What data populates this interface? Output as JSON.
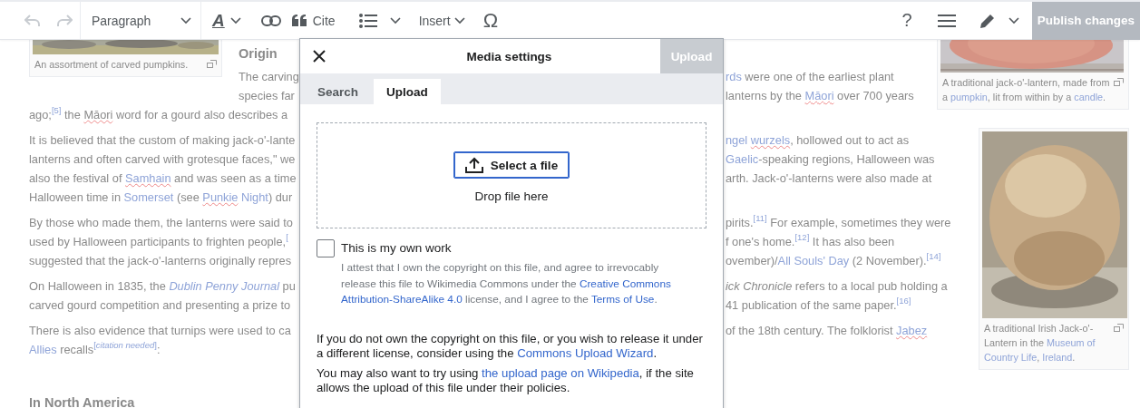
{
  "toolbar": {
    "undo": {
      "disabled": true
    },
    "redo": {
      "disabled": true
    },
    "paragraph_format": "Paragraph",
    "text_style": "A",
    "cite": "Cite",
    "insert": "Insert",
    "special_character": "Ω",
    "help": "?",
    "publish": {
      "label": "Publish changes",
      "disabled": true
    }
  },
  "article": {
    "left_figure": {
      "caption": [
        {
          "kind": "text",
          "s": "An assortment of carved pumpkins."
        }
      ]
    },
    "right_figures": [
      {
        "caption": [
          {
            "kind": "text",
            "s": "A traditional jack-o'-lantern, made from a "
          },
          {
            "kind": "link",
            "s": "pumpkin"
          },
          {
            "kind": "text",
            "s": ", lit from within by a "
          },
          {
            "kind": "link",
            "s": "candle"
          },
          {
            "kind": "text",
            "s": "."
          }
        ]
      },
      {
        "caption": [
          {
            "kind": "text",
            "s": "A traditional Irish Jack-o'-Lantern in the "
          },
          {
            "kind": "link",
            "s": "Museum of "
          },
          {
            "kind": "link",
            "s": "Country Life"
          },
          {
            "kind": "text",
            "s": ", "
          },
          {
            "kind": "link",
            "s": "Ireland"
          },
          {
            "kind": "text",
            "s": "."
          }
        ]
      }
    ],
    "blocks": [
      {
        "kind": "heading",
        "text": "Origin"
      },
      {
        "kind": "paragraph",
        "lines": [
          {
            "left": [
              {
                "kind": "text",
                "s": "The carving"
              }
            ],
            "right": [
              {
                "kind": "link",
                "s": "rds"
              },
              {
                "kind": "text",
                "s": " were one of the earliest plant"
              }
            ]
          },
          {
            "left": [
              {
                "kind": "text",
                "s": "species far"
              }
            ],
            "right": [
              {
                "kind": "text",
                "s": "lanterns by the "
              },
              {
                "kind": "link-misspelled",
                "s": "Māori"
              },
              {
                "kind": "text",
                "s": " over 700 years"
              }
            ]
          },
          {
            "left": [
              {
                "kind": "text",
                "s": "ago;"
              },
              {
                "kind": "ref",
                "s": "[5]"
              },
              {
                "kind": "text",
                "s": " the "
              },
              {
                "kind": "text-misspelled",
                "s": "Māori"
              },
              {
                "kind": "text",
                "s": " word for a gourd also describes a"
              }
            ]
          }
        ]
      },
      {
        "kind": "paragraph",
        "lines": [
          {
            "left": [
              {
                "kind": "text",
                "s": "It is believed that the custom of making jack-o'-lante"
              }
            ],
            "right": [
              {
                "kind": "link",
                "s": "ngel "
              },
              {
                "kind": "link-misspelled",
                "s": "wurzels"
              },
              {
                "kind": "text",
                "s": ", hollowed out to act as"
              }
            ]
          },
          {
            "left": [
              {
                "kind": "text",
                "s": "lanterns and often carved with grotesque faces,\" we"
              }
            ],
            "right": [
              {
                "kind": "link",
                "s": "Gaelic"
              },
              {
                "kind": "text",
                "s": "-speaking regions, Halloween was"
              }
            ]
          },
          {
            "left": [
              {
                "kind": "text",
                "s": "also the festival of "
              },
              {
                "kind": "link-misspelled",
                "s": "Samhain"
              },
              {
                "kind": "text",
                "s": " and was seen as a time"
              }
            ],
            "right": [
              {
                "kind": "text",
                "s": "arth. Jack-o'-lanterns were also made at"
              }
            ]
          },
          {
            "left": [
              {
                "kind": "text",
                "s": "Halloween time in "
              },
              {
                "kind": "link",
                "s": "Somerset"
              },
              {
                "kind": "text",
                "s": " (see "
              },
              {
                "kind": "link-misspelled",
                "s": "Punkie"
              },
              {
                "kind": "link",
                "s": " Night"
              },
              {
                "kind": "text",
                "s": ") dur"
              }
            ]
          }
        ]
      },
      {
        "kind": "paragraph",
        "lines": [
          {
            "left": [
              {
                "kind": "text",
                "s": "By those who made them, the lanterns were said to"
              }
            ],
            "right": [
              {
                "kind": "text",
                "s": "pirits."
              },
              {
                "kind": "ref",
                "s": "[11]"
              },
              {
                "kind": "text",
                "s": " For example, sometimes they were"
              }
            ]
          },
          {
            "left": [
              {
                "kind": "text",
                "s": "used by Halloween participants to frighten people,"
              },
              {
                "kind": "ref",
                "s": "["
              }
            ],
            "right": [
              {
                "kind": "text",
                "s": "f one's home."
              },
              {
                "kind": "ref",
                "s": "[12]"
              },
              {
                "kind": "text",
                "s": " It has also been"
              }
            ]
          },
          {
            "left": [
              {
                "kind": "text",
                "s": "suggested that the jack-o'-lanterns originally repres"
              }
            ],
            "right": [
              {
                "kind": "text",
                "s": "ovember)/"
              },
              {
                "kind": "link",
                "s": "All Souls' Day"
              },
              {
                "kind": "text",
                "s": " (2 November)."
              },
              {
                "kind": "ref",
                "s": "[14]"
              }
            ]
          }
        ]
      },
      {
        "kind": "paragraph",
        "lines": [
          {
            "left": [
              {
                "kind": "text",
                "s": "On Halloween in 1835, the "
              },
              {
                "kind": "italic-link",
                "s": "Dublin Penny Journal"
              },
              {
                "kind": "text",
                "s": " pu"
              }
            ],
            "right": [
              {
                "kind": "italic",
                "s": "ick Chronicle"
              },
              {
                "kind": "text",
                "s": " refers to a local pub holding a"
              }
            ]
          },
          {
            "left": [
              {
                "kind": "text",
                "s": "carved gourd competition and presenting a prize to"
              }
            ],
            "right": [
              {
                "kind": "text",
                "s": "41 publication of the same paper."
              },
              {
                "kind": "ref",
                "s": "[16]"
              }
            ]
          }
        ]
      },
      {
        "kind": "paragraph",
        "lines": [
          {
            "left": [
              {
                "kind": "text",
                "s": "There is also evidence that turnips were used to ca"
              }
            ],
            "right": [
              {
                "kind": "text",
                "s": "of the 18th century. The folklorist "
              },
              {
                "kind": "link-misspelled",
                "s": "Jabez"
              }
            ]
          },
          {
            "left": [
              {
                "kind": "link",
                "s": "Allies"
              },
              {
                "kind": "text",
                "s": " recalls"
              },
              {
                "kind": "ref",
                "s": "[*citation needed*]"
              },
              {
                "kind": "text",
                "s": ":"
              }
            ]
          }
        ]
      },
      {
        "kind": "heading",
        "text": "In North America"
      }
    ]
  },
  "dialog": {
    "title": "Media settings",
    "action": {
      "label": "Upload",
      "disabled": true
    },
    "tabs": [
      {
        "label": "Search",
        "selected": false
      },
      {
        "label": "Upload",
        "selected": true
      }
    ],
    "select_button": "Select a file",
    "drop_hint": "Drop file here",
    "own_work": {
      "label": "This is my own work",
      "checked": false,
      "description": [
        {
          "kind": "text",
          "s": "I attest that I own the copyright on this file, and agree to irrevocably release this file to Wikimedia Commons under the "
        },
        {
          "kind": "link",
          "s": "Creative Commons "
        },
        {
          "kind": "link",
          "s": "Attribution-ShareAlike 4.0"
        },
        {
          "kind": "text",
          "s": " license, and I agree to the "
        },
        {
          "kind": "link",
          "s": "Terms of Use"
        },
        {
          "kind": "text",
          "s": "."
        }
      ]
    },
    "notes": [
      [
        {
          "kind": "text",
          "s": "If you do not own the copyright on this file, or you wish to release it under a different license, consider using the "
        },
        {
          "kind": "link",
          "s": "Commons Upload Wizard"
        },
        {
          "kind": "text",
          "s": "."
        }
      ],
      [
        {
          "kind": "text",
          "s": "You may also want to try using "
        },
        {
          "kind": "link",
          "s": "the upload page on Wikipedia"
        },
        {
          "kind": "text",
          "s": ", if the site allows the upload of this file under their policies."
        }
      ]
    ]
  }
}
